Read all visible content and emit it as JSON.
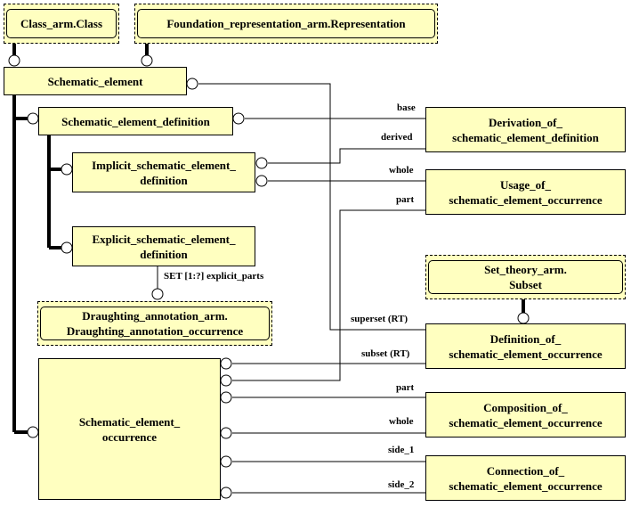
{
  "diagram": {
    "type": "EXPRESS-G ARM diagram",
    "external_entities": {
      "class": "Class_arm.Class",
      "foundation": "Foundation_representation_arm.Representation",
      "draughting_line1": "Draughting_annotation_arm.",
      "draughting_line2": "Draughting_annotation_occurrence",
      "set_theory_line1": "Set_theory_arm.",
      "set_theory_line2": "Subset"
    },
    "entities": {
      "schematic_element": "Schematic_element",
      "schematic_element_definition": "Schematic_element_definition",
      "implicit_line1": "Implicit_schematic_element_",
      "implicit_line2": "definition",
      "explicit_line1": "Explicit_schematic_element_",
      "explicit_line2": "definition",
      "occurrence_line1": "Schematic_element_",
      "occurrence_line2": "occurrence",
      "derivation_line1": "Derivation_of_",
      "derivation_line2": "schematic_element_definition",
      "usage_line1": "Usage_of_",
      "usage_line2": "schematic_element_occurrence",
      "definition_of_line1": "Definition_of_",
      "definition_of_line2": "schematic_element_occurrence",
      "composition_line1": "Composition_of_",
      "composition_line2": "schematic_element_occurrence",
      "connection_line1": "Connection_of_",
      "connection_line2": "schematic_element_occurrence"
    },
    "attributes": {
      "base": "base",
      "derived": "derived",
      "whole_usage": "whole",
      "part_usage": "part",
      "explicit_parts": "SET [1:?] explicit_parts",
      "superset": "superset (RT)",
      "subset": "subset (RT)",
      "part_composition": "part",
      "whole_composition": "whole",
      "side_1": "side_1",
      "side_2": "side_2"
    },
    "colors": {
      "entity_fill": "#ffffc0",
      "line": "#000000",
      "background": "#ffffff"
    }
  }
}
